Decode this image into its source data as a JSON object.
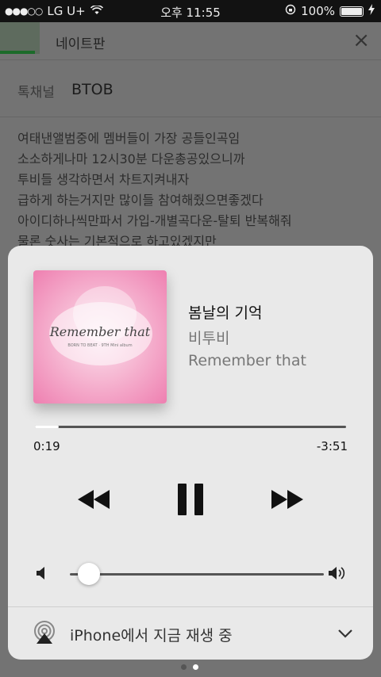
{
  "status_bar": {
    "signal": "●●●○○",
    "carrier": "LG U+",
    "wifi_icon": "wifi-icon",
    "time": "오후 11:55",
    "battery_percent": "100%",
    "rotation_lock_icon": "rotation-lock-icon",
    "charging_icon": "charging-bolt-icon"
  },
  "background_app": {
    "title": "네이트판",
    "close_glyph": "×",
    "channel_label": "톡채널",
    "channel_value": "BTOB",
    "body_lines": [
      "여태낸앨범중에 멤버들이 가장 공들인곡임",
      "소소하게나마 12시30분 다운총공있으니까",
      "투비들 생각하면서 차트지켜내자",
      "급하게 하는거지만 많이들 참여해줬으면좋겠다",
      "아이디하나씩만파서 가입-개별곡다운-탈퇴 반복해줘",
      "물론 숫사는 기본적으로 하고있겠지만"
    ]
  },
  "now_playing": {
    "song_title": "봄날의 기억",
    "artist": "비투비",
    "album": "Remember that",
    "artwork_text": "Remember that",
    "artwork_subtext": "BORN TO BEAT · 9TH Mini album",
    "elapsed": "0:19",
    "remaining": "-3:51",
    "progress_fraction": 0.077,
    "volume_fraction": 0.03,
    "route_label": "iPhone에서 지금 재생 중"
  },
  "page_indicator": {
    "count": 2,
    "active": 1
  },
  "colors": {
    "card_bg": "#e9e9e9",
    "artwork_pink": "#ee7fb0",
    "track": "#555555",
    "text_primary": "#111111",
    "text_secondary": "#777777"
  }
}
